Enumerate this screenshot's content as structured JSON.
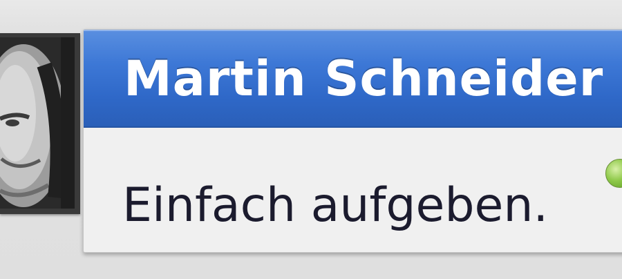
{
  "contact": {
    "name": "Martin Schneider",
    "status_message": "Einfach aufgeben.",
    "status": "available",
    "avatar_icon": "user-photo"
  },
  "colors": {
    "header_blue": "#3d78d6",
    "card_background": "#f0f0f0",
    "status_green": "#8fc94a"
  }
}
